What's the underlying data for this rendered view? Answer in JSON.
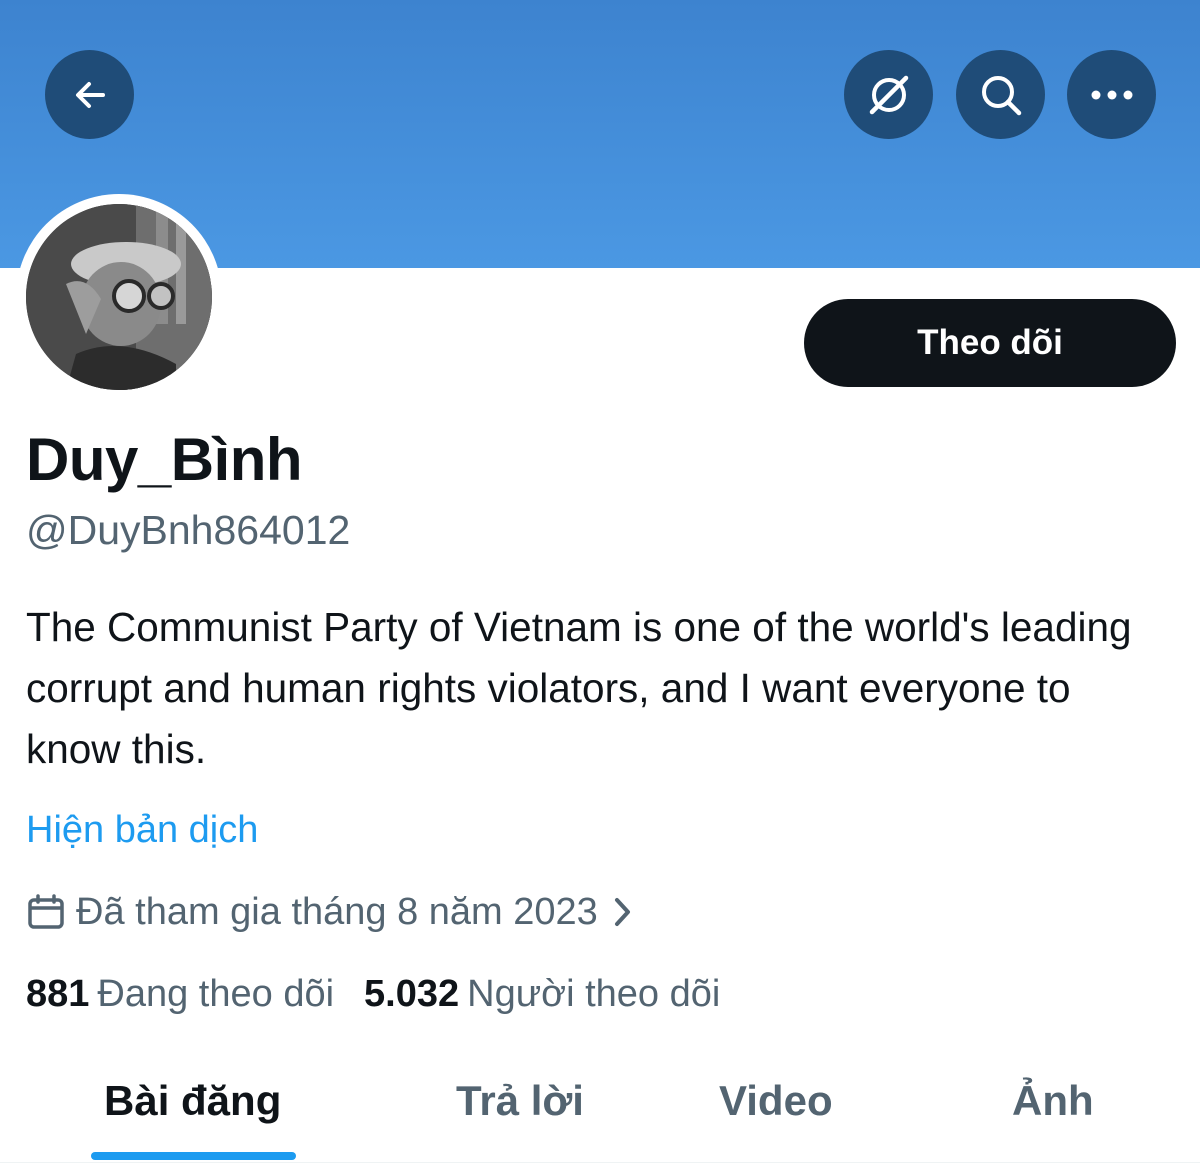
{
  "header": {
    "back_icon": "arrow-left-icon",
    "grok_icon": "grok-icon",
    "search_icon": "search-icon",
    "more_icon": "more-horizontal-icon",
    "banner_color": "#4a93de",
    "button_bg": "#1f4c78"
  },
  "profile": {
    "display_name": "Duy_Bình",
    "handle": "@DuyBnh864012",
    "follow_label": "Theo dõi",
    "bio": "The Communist Party of Vietnam is one of the world's leading corrupt and human rights violators, and I want everyone to know this.",
    "translate_label": "Hiện bản dịch",
    "joined_text": "Đã tham gia tháng 8 năm 2023",
    "calendar_icon": "calendar-icon",
    "chevron_icon": "chevron-right-icon"
  },
  "stats": {
    "following_count": "881",
    "following_label": "Đang theo dõi",
    "followers_count": "5.032",
    "followers_label": "Người theo dõi"
  },
  "tabs": [
    {
      "label": "Bài đăng",
      "active": true
    },
    {
      "label": "Trả lời",
      "active": false
    },
    {
      "label": "Video",
      "active": false
    },
    {
      "label": "Ảnh",
      "active": false
    }
  ],
  "colors": {
    "accent": "#1d9bf0",
    "text_primary": "#0f1419",
    "text_secondary": "#536471"
  }
}
